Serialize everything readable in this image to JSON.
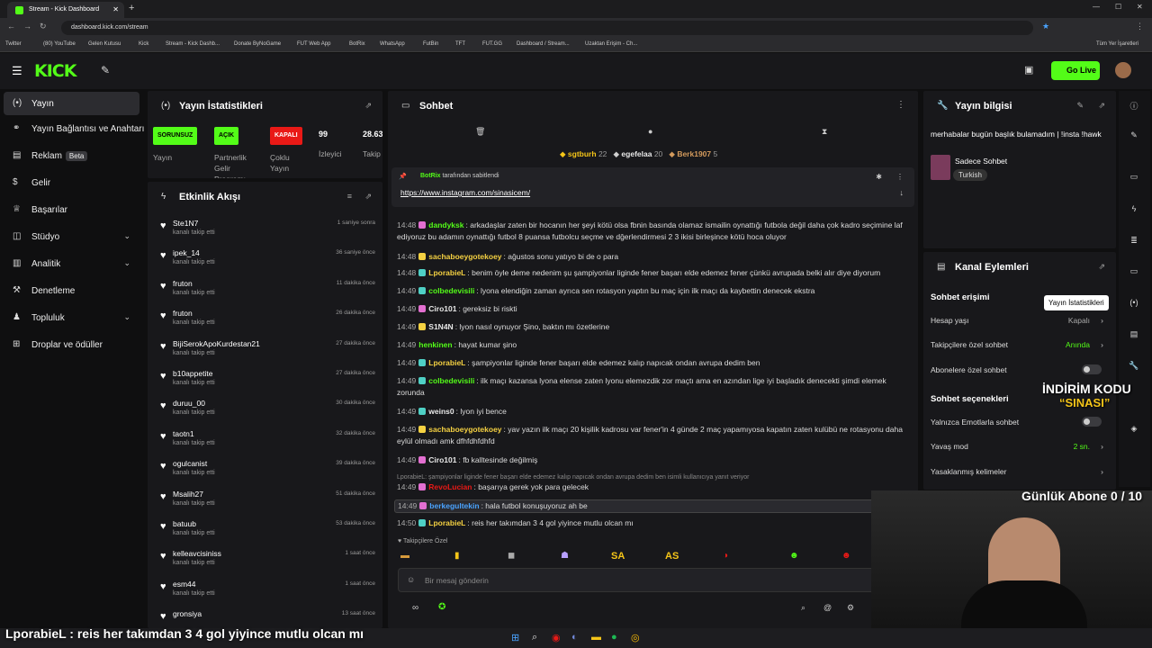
{
  "browser": {
    "tabs": [
      "Stream - Kick Dashboard"
    ],
    "address": "dashboard.kick.com/stream",
    "bookmarks": [
      "Twitter",
      "(80) YouTube",
      "Gelen Kutusu",
      "Kick",
      "Stream - Kick Dashb...",
      "Donate ByNoGame",
      "FUT Web App",
      "BotRix",
      "WhatsApp",
      "FutBin",
      "TFT",
      "FUT.GG",
      "Dashboard / Stream...",
      "Uzaktan Erişim - Ch..."
    ],
    "bookmarks_right": "Tüm Yer İşaretleri"
  },
  "header": {
    "logo": "KICK",
    "go_live": "Go Live"
  },
  "nav": [
    {
      "label": "Yayın",
      "icon": "broadcast-icon",
      "active": true
    },
    {
      "label": "Yayın Bağlantısı ve Anahtarı",
      "icon": "link-icon"
    },
    {
      "label": "Reklam",
      "icon": "ad-icon",
      "badge": "Beta"
    },
    {
      "label": "Gelir",
      "icon": "money-icon"
    },
    {
      "label": "Başarılar",
      "icon": "trophy-icon"
    },
    {
      "label": "Stüdyo",
      "icon": "studio-icon",
      "chevron": true
    },
    {
      "label": "Analitik",
      "icon": "chart-icon",
      "chevron": true
    },
    {
      "label": "Denetleme",
      "icon": "hammer-icon"
    },
    {
      "label": "Topluluk",
      "icon": "community-icon",
      "chevron": true
    },
    {
      "label": "Droplar ve ödüller",
      "icon": "gift-icon"
    }
  ],
  "stats": {
    "title": "Yayın İstatistikleri",
    "items": [
      {
        "badge": "SORUNSUZ",
        "badge_color": "#53fc18",
        "badge_text_color": "#000",
        "label": "Yayın"
      },
      {
        "badge": "AÇIK",
        "badge_color": "#53fc18",
        "badge_text_color": "#000",
        "label": "Partnerlik Gelir Programı"
      },
      {
        "badge": "KAPALI",
        "badge_color": "#e91916",
        "badge_text_color": "#fff",
        "label": "Çoklu Yayın"
      },
      {
        "value": "99",
        "label": "İzleyici"
      },
      {
        "value": "28.63",
        "label": "Takip"
      }
    ]
  },
  "activity": {
    "title": "Etkinlik Akışı",
    "items": [
      {
        "name": "Ste1N7",
        "sub": "kanalı takip etti",
        "time": "1 saniye sonra"
      },
      {
        "name": "ipek_14",
        "sub": "kanalı takip etti",
        "time": "36 saniye önce"
      },
      {
        "name": "fruton",
        "sub": "kanalı takip etti",
        "time": "11 dakika önce"
      },
      {
        "name": "fruton",
        "sub": "kanalı takip etti",
        "time": "26 dakika önce"
      },
      {
        "name": "BijiSerokApoKurdestan21",
        "sub": "kanalı takip etti",
        "time": "27 dakika önce"
      },
      {
        "name": "b10appetite",
        "sub": "kanalı takip etti",
        "time": "27 dakika önce"
      },
      {
        "name": "duruu_00",
        "sub": "kanalı takip etti",
        "time": "30 dakika önce"
      },
      {
        "name": "taotn1",
        "sub": "kanalı takip etti",
        "time": "32 dakika önce"
      },
      {
        "name": "ogulcanist",
        "sub": "kanalı takip etti",
        "time": "39 dakika önce"
      },
      {
        "name": "Msalih27",
        "sub": "kanalı takip etti",
        "time": "51 dakika önce"
      },
      {
        "name": "batuub",
        "sub": "kanalı takip etti",
        "time": "53 dakika önce"
      },
      {
        "name": "kelleavcisiniss",
        "sub": "kanalı takip etti",
        "time": "1 saat önce"
      },
      {
        "name": "esm44",
        "sub": "kanalı takip etti",
        "time": "1 saat önce"
      },
      {
        "name": "gronsiya",
        "sub": "",
        "time": "13 saat önce"
      }
    ]
  },
  "chat": {
    "title": "Sohbet",
    "top_users": [
      {
        "name": "sgtburh",
        "count": "22",
        "color": "#f5c518"
      },
      {
        "name": "egefelaa",
        "count": "20",
        "color": "#cfcfcf"
      },
      {
        "name": "Berk1907",
        "count": "5",
        "color": "#d39a5c"
      }
    ],
    "pinned_by": "BotRix",
    "pinned_suffix": "tarafından sabitlendi",
    "pinned_link": "https://www.instagram.com/sinasicem/",
    "messages": [
      {
        "time": "14:48",
        "user": "dandyksk",
        "color": "#53fc18",
        "text": "arkadaşlar zaten bir hocanın her şeyi kötü olsa fbnin basında olamaz ismailin oynattığı futbola değil daha çok kadro seçimine laf ediyoruz bu adamın oynattığı futbol 8 puansa futbolcu seçme ve dğerlendirmesi 2 3 ikisi birleşince kötü hoca oluyor"
      },
      {
        "time": "14:48",
        "user": "sachaboeygotekoey",
        "color": "#f5d142",
        "text": "ağustos sonu yatıyo bi de o para"
      },
      {
        "time": "14:48",
        "user": "LporabieL",
        "color": "#f5d142",
        "text": "benim öyle deme nedenim şu şampiyonlar liginde fener başarı elde edemez fener çünkü avrupada belki alır diye diyorum"
      },
      {
        "time": "14:49",
        "user": "colbedevisili",
        "color": "#53fc18",
        "text": "lyona elendiğin zaman ayrıca sen rotasyon yaptın bu maç için ilk maçı da kaybettin denecek ekstra"
      },
      {
        "time": "14:49",
        "user": "Ciro101",
        "color": "#e8e8e8",
        "text": "gereksiz bi riskti"
      },
      {
        "time": "14:49",
        "user": "S1N4N",
        "color": "#e8e8e8",
        "text": "lyon nasıl oynuyor Şino, baktın mı özetlerine"
      },
      {
        "time": "14:49",
        "user": "henkinen",
        "color": "#53fc18",
        "text": "hayat kumar şino"
      },
      {
        "time": "14:49",
        "user": "LporabieL",
        "color": "#f5d142",
        "text": "şampiyonlar liginde fener başarı elde edemez kalıp napıcak ondan avrupa dedim ben"
      },
      {
        "time": "14:49",
        "user": "colbedevisili",
        "color": "#53fc18",
        "text": "ilk maçı kazansa lyona elense zaten lyonu elemezdik zor maçtı ama en azından lige iyi başladık denecekti şimdi elemek zorunda"
      },
      {
        "time": "14:49",
        "user": "weins0",
        "color": "#e8e8e8",
        "text": "lyon iyi bence"
      },
      {
        "time": "14:49",
        "user": "sachaboeygotekoey",
        "color": "#f5d142",
        "text": "yav yazın ilk maçı 20 kişilik kadrosu var fener'in 4 günde 2 maç yapamıyosa kapatın zaten kulübü ne rotasyonu daha eylül olmadı amk dfhfdhfdhfd"
      },
      {
        "time": "14:49",
        "user": "Ciro101",
        "color": "#e8e8e8",
        "text": "fb kalltesinde değilmiş"
      },
      {
        "time": "",
        "user": "",
        "color": "#aaa",
        "text": "LporabieL: şampiyonlar liginde fener başarı elde edemez kalıp napıcak ondan avrupa dedim ben isimli kullanıcıya yanıt veriyor"
      },
      {
        "time": "14:49",
        "user": "RevoLucian",
        "color": "#e91916",
        "text": "başarıya gerek yok para gelecek"
      },
      {
        "time": "14:49",
        "user": "berkegultekin",
        "color": "#4aa3ff",
        "text": "hala futbol konuşuyoruz ah be"
      },
      {
        "time": "14:50",
        "user": "LporabieL",
        "color": "#f5d142",
        "text": "reis her takımdan 3 4 gol yiyince mutlu olcan mı"
      }
    ],
    "followers_only": "Takipçilere Özel",
    "emotes": [
      "SA",
      "AS"
    ],
    "input_placeholder": "Bir mesaj gönderin"
  },
  "stream_info": {
    "title": "Yayın bilgisi",
    "stream_title": "merhabalar bugün başlık bulamadım | !insta !hawk",
    "category": "Sadece Sohbet",
    "language": "Turkish"
  },
  "channel_actions": {
    "title": "Kanal Eylemleri",
    "access_section": "Sohbet erişimi",
    "tooltip": "Yayın İstatistikleri",
    "account_age": {
      "label": "Hesap yaşı",
      "value": "Kapalı"
    },
    "followers_only": {
      "label": "Takipçilere özel sohbet",
      "value": "Anında"
    },
    "subs_only": {
      "label": "Abonelere özel sohbet"
    },
    "options_section": "Sohbet seçenekleri",
    "emotes_only": {
      "label": "Yalnızca Emotlarla sohbet"
    },
    "slow_mode": {
      "label": "Yavaş mod",
      "value": "2 sn."
    },
    "banned_words": {
      "label": "Yasaklanmış kelimeler"
    }
  },
  "overlay": {
    "discount_line1": "İNDİRİM KODU",
    "discount_line2": "“SINASI”",
    "subs_goal": "Günlük Abone 0 / 10",
    "bottom_message": "LporabieL : reis her takımdan 3 4 gol yiyince mutlu olcan mı"
  },
  "colors": {
    "accent": "#53fc18",
    "panel": "#18181b",
    "background": "#0f0f10"
  }
}
